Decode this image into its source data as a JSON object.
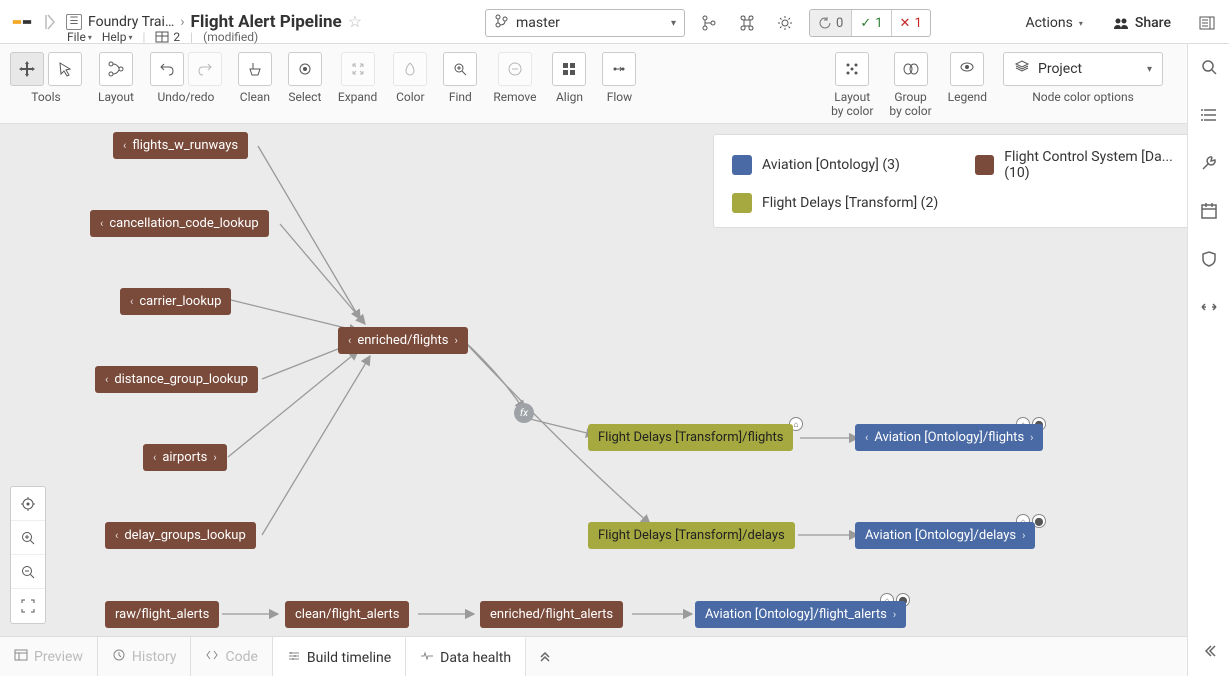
{
  "header": {
    "breadcrumb_parent": "Foundry Trai…",
    "title": "Flight Alert Pipeline",
    "menu_file": "File",
    "menu_help": "Help",
    "tab_count": "2",
    "modified": "(modified)",
    "branch": "master",
    "status_refresh": "0",
    "status_ok": "1",
    "status_err": "1",
    "actions": "Actions",
    "share": "Share"
  },
  "toolbar": {
    "tools": "Tools",
    "layout": "Layout",
    "undoredo": "Undo/redo",
    "clean": "Clean",
    "select": "Select",
    "expand": "Expand",
    "color": "Color",
    "find": "Find",
    "remove": "Remove",
    "align": "Align",
    "flow": "Flow",
    "layout_by_color": "Layout\nby color",
    "group_by_color": "Group\nby color",
    "legend": "Legend",
    "node_color_options": "Node color options",
    "project": "Project"
  },
  "legend": {
    "aviation": "Aviation [Ontology] (3)",
    "fcs": "Flight Control System [Da... (10)",
    "delays": "Flight Delays [Transform] (2)"
  },
  "nodes": {
    "flights_w_runways": "flights_w_runways",
    "cancellation_code_lookup": "cancellation_code_lookup",
    "carrier_lookup": "carrier_lookup",
    "distance_group_lookup": "distance_group_lookup",
    "airports": "airports",
    "delay_groups_lookup": "delay_groups_lookup",
    "enriched_flights": "enriched/flights",
    "fd_flights": "Flight Delays [Transform]/flights",
    "fd_delays": "Flight Delays [Transform]/delays",
    "av_flights": "Aviation [Ontology]/flights",
    "av_delays": "Aviation [Ontology]/delays",
    "raw_flight_alerts": "raw/flight_alerts",
    "clean_flight_alerts": "clean/flight_alerts",
    "enriched_flight_alerts": "enriched/flight_alerts",
    "av_flight_alerts": "Aviation [Ontology]/flight_alerts"
  },
  "bottom": {
    "preview": "Preview",
    "history": "History",
    "code": "Code",
    "build": "Build timeline",
    "health": "Data health"
  },
  "colors": {
    "brown": "#7a4a3a",
    "olive": "#a5a93f",
    "blue": "#4a6aa5"
  }
}
